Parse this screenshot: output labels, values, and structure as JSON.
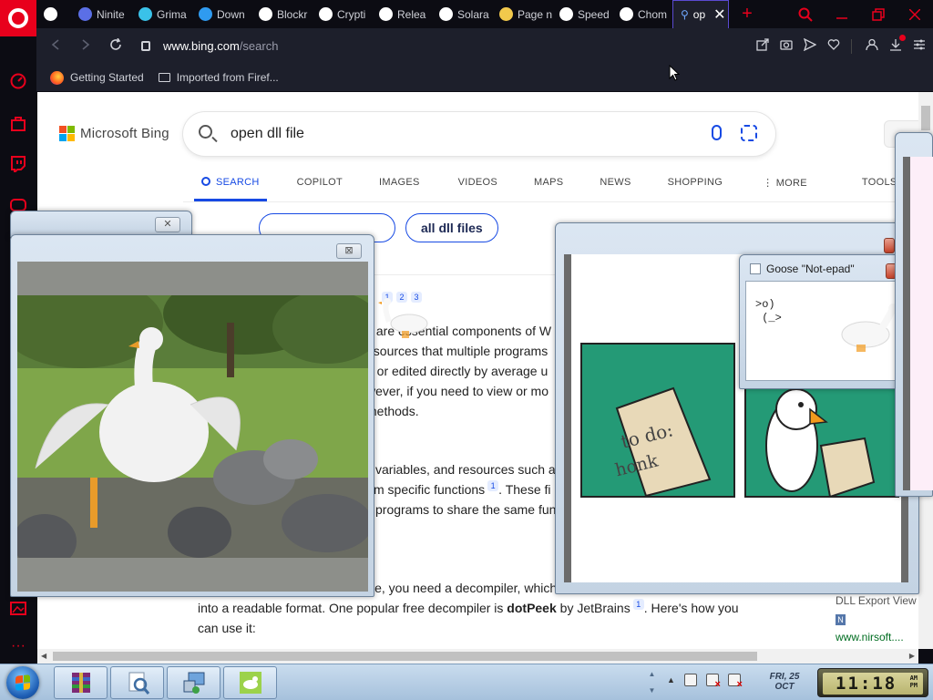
{
  "tabs": [
    {
      "label": "",
      "icon": "globe-icon",
      "color": "#ffffff"
    },
    {
      "label": "Ninite",
      "icon": "ninite-icon",
      "color": "#5b6fe6"
    },
    {
      "label": "Grima",
      "icon": "play-icon",
      "color": "#3ac2e9"
    },
    {
      "label": "Down",
      "icon": "download-diamond-icon",
      "color": "#2f9bf0"
    },
    {
      "label": "Blockr",
      "icon": "globe-icon",
      "color": "#ffffff"
    },
    {
      "label": "Crypti",
      "icon": "f-icon",
      "color": "#ffffff"
    },
    {
      "label": "Relea",
      "icon": "github-icon",
      "color": "#ffffff"
    },
    {
      "label": "Solara",
      "icon": "globe-icon",
      "color": "#ffffff"
    },
    {
      "label": "Page n",
      "icon": "headphones-icon",
      "color": "#f2c94c"
    },
    {
      "label": "Speed",
      "icon": "grid-icon",
      "color": "#ffffff"
    },
    {
      "label": "Chom",
      "icon": "museum-icon",
      "color": "#ffffff"
    }
  ],
  "active_tab": {
    "label": "op",
    "icon": "search-icon"
  },
  "address": {
    "host": "www.bing.com",
    "path": "/search"
  },
  "bookmarks": [
    {
      "label": "Getting Started",
      "icon": "firefox-icon"
    },
    {
      "label": "Imported from Firef...",
      "icon": "folder-icon"
    }
  ],
  "bing": {
    "brand": "Microsoft Bing",
    "query": "open dll file",
    "nav": [
      "SEARCH",
      "COPILOT",
      "IMAGES",
      "VIDEOS",
      "MAPS",
      "NEWS",
      "SHOPPING",
      "MORE",
      "TOOLS"
    ],
    "chips": [
      "all dll files"
    ],
    "cites": [
      "1",
      "2",
      "3"
    ],
    "snippet1": [
      "s are essential components of W",
      "esources that multiple programs",
      "d or edited directly by average u",
      "wever, if you need to view or mo",
      "methods."
    ],
    "snippet2": [
      " variables, and resources such a",
      "m specific functions",
      ". These fi",
      "programs to share the same fun"
    ],
    "snippet3": {
      "line1": "le, you need a decompiler, which",
      "line2_pre": "into a readable format. One popular free decompiler is ",
      "line2_bold": "dotPeek",
      "line2_post": " by JetBrains",
      "line3": ". Here's how you",
      "line4": "can use it:"
    },
    "right_panel": {
      "title": "DLL Export View",
      "link": "www.nirsoft...."
    }
  },
  "goose": {
    "notepad_title": "Goose \"Not-epad\"",
    "notepad_text": ">o)\n (_>",
    "comic_scroll_line1": "to do:",
    "comic_scroll_line2": "honk"
  },
  "taskbar": {
    "date_day": "FRI, 25",
    "date_month": "OCT",
    "clock": "11:18",
    "ampm_top": "AM",
    "ampm_bottom": "PM"
  }
}
